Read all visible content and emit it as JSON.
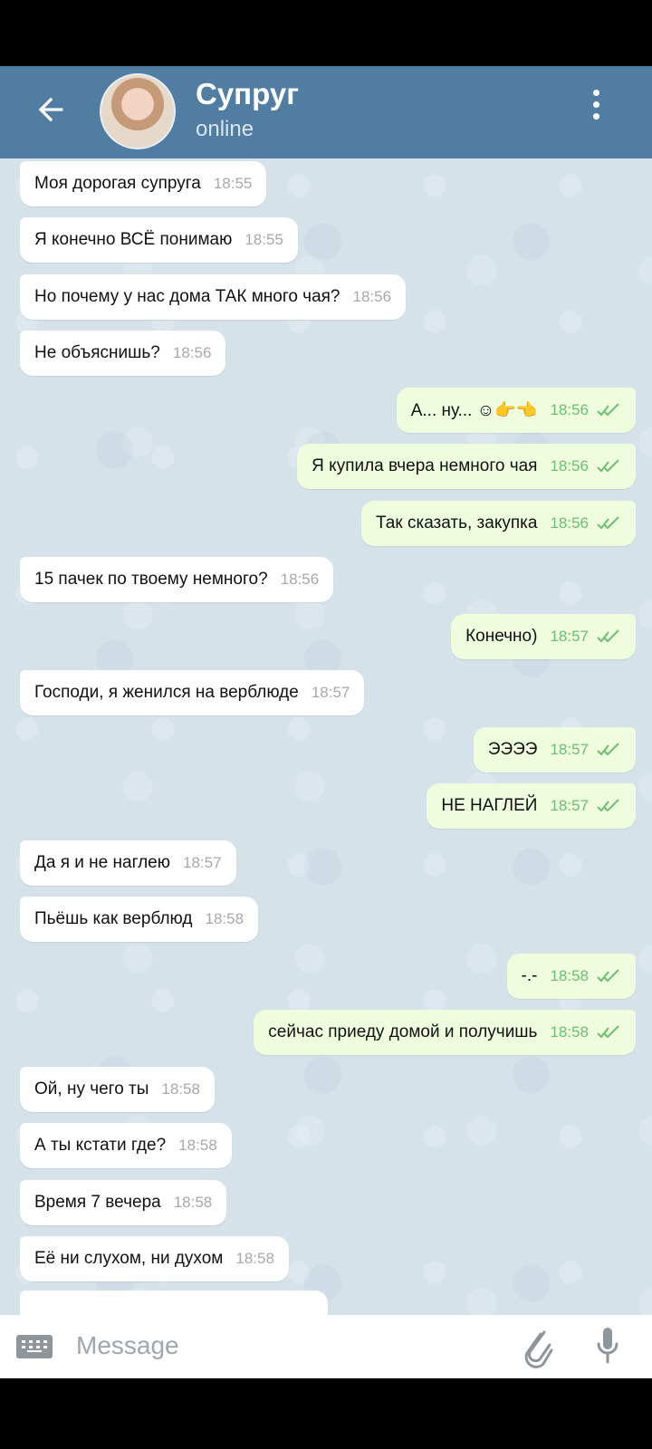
{
  "header": {
    "contact_name": "Супруг",
    "status": "online",
    "icons": {
      "back": "back-arrow-icon",
      "more": "more-vertical-icon",
      "avatar": "avatar"
    }
  },
  "messages": [
    {
      "text": "Моя дорогая супруга",
      "time": "18:55",
      "dir": "in"
    },
    {
      "text": "Я конечно ВСЁ понимаю",
      "time": "18:55",
      "dir": "in"
    },
    {
      "text": "Но почему у нас дома ТАК много чая?",
      "time": "18:56",
      "dir": "in"
    },
    {
      "text": "Не объяснишь?",
      "time": "18:56",
      "dir": "in"
    },
    {
      "text": "А... ну... ☺👉👈",
      "time": "18:56",
      "dir": "out"
    },
    {
      "text": "Я купила вчера немного чая",
      "time": "18:56",
      "dir": "out"
    },
    {
      "text": "Так сказать, закупка",
      "time": "18:56",
      "dir": "out"
    },
    {
      "text": "15 пачек по твоему немного?",
      "time": "18:56",
      "dir": "in"
    },
    {
      "text": "Конечно)",
      "time": "18:57",
      "dir": "out"
    },
    {
      "text": "Господи, я женился на верблюде",
      "time": "18:57",
      "dir": "in"
    },
    {
      "text": "ЭЭЭЭ",
      "time": "18:57",
      "dir": "out"
    },
    {
      "text": "НЕ НАГЛЕЙ",
      "time": "18:57",
      "dir": "out"
    },
    {
      "text": "Да я и не наглею",
      "time": "18:57",
      "dir": "in"
    },
    {
      "text": "Пьёшь как верблюд",
      "time": "18:58",
      "dir": "in"
    },
    {
      "text": "-.-",
      "time": "18:58",
      "dir": "out"
    },
    {
      "text": "сейчас приеду домой и получишь",
      "time": "18:58",
      "dir": "out"
    },
    {
      "text": "Ой, ну чего ты",
      "time": "18:58",
      "dir": "in"
    },
    {
      "text": "А ты кстати где?",
      "time": "18:58",
      "dir": "in"
    },
    {
      "text": "Время 7 вечера",
      "time": "18:58",
      "dir": "in"
    },
    {
      "text": "Её ни слухом, ни духом",
      "time": "18:58",
      "dir": "in"
    }
  ],
  "input": {
    "placeholder": "Message",
    "icons": {
      "keyboard": "keyboard-icon",
      "attach": "paperclip-icon",
      "mic": "microphone-icon"
    }
  },
  "colors": {
    "header": "#517da2",
    "incoming_bubble": "#ffffff",
    "outgoing_bubble": "#effdde",
    "read_checks": "#6cbe72"
  }
}
